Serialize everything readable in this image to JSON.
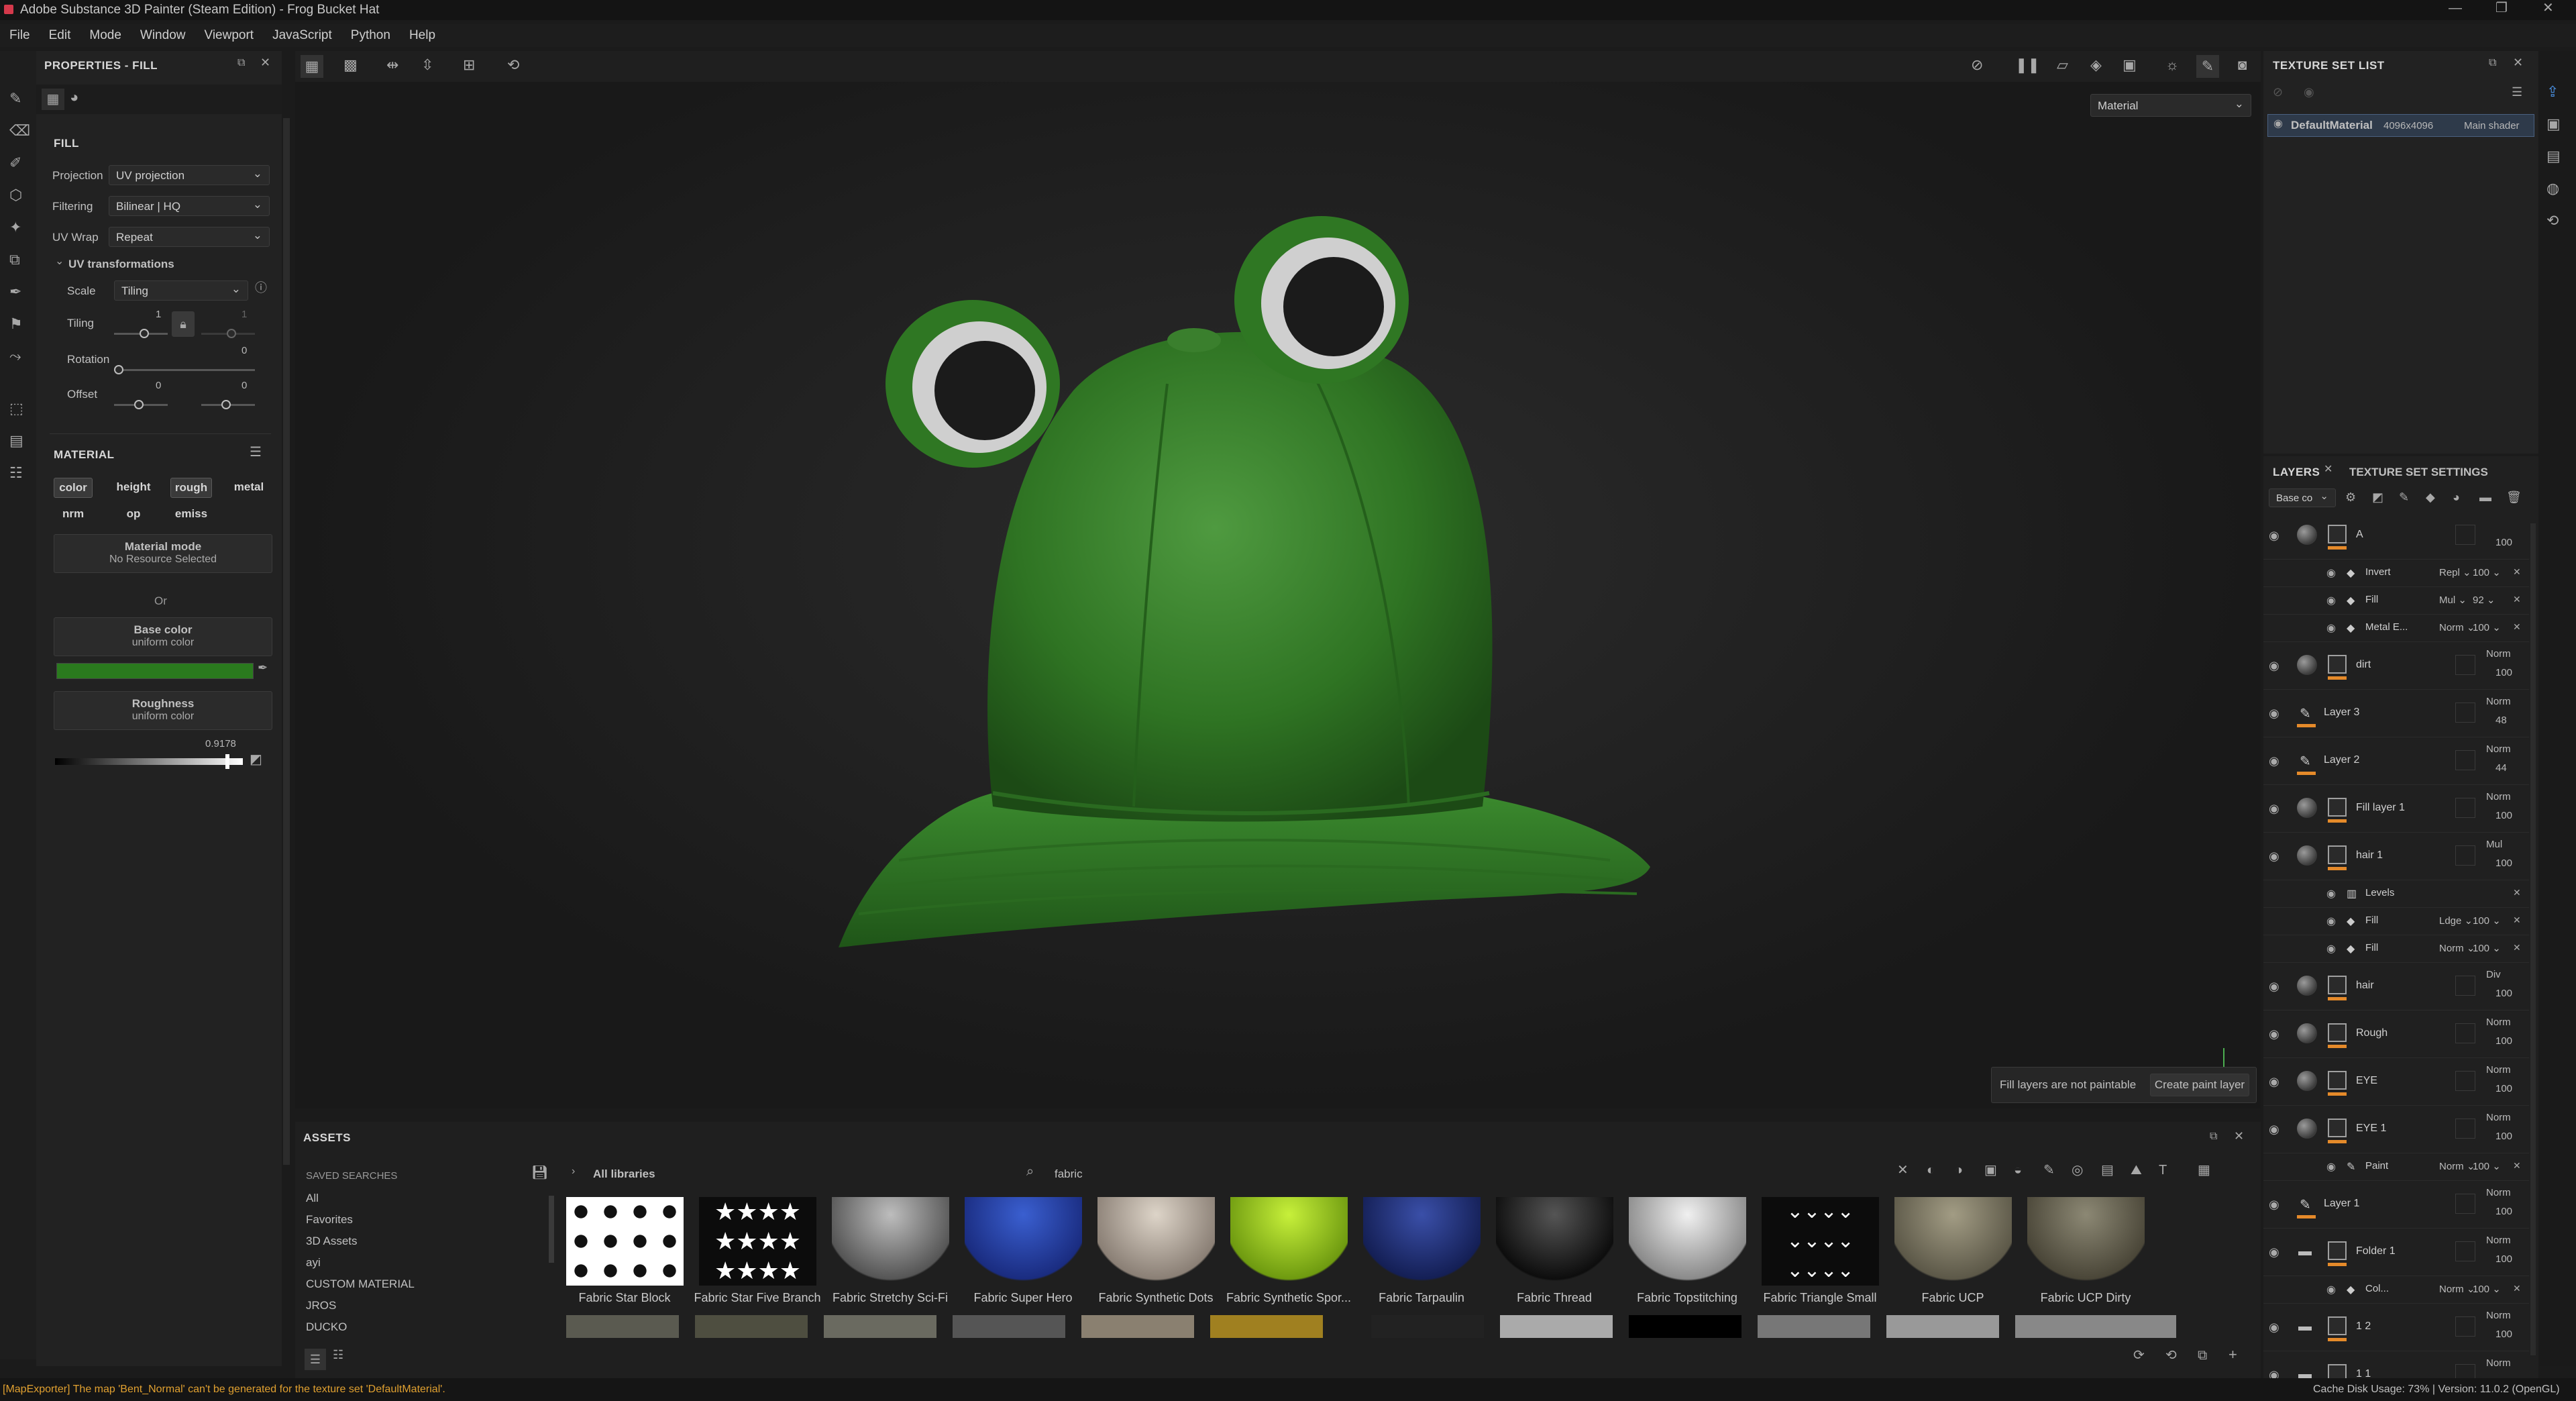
{
  "window": {
    "title": "Adobe Substance 3D Painter (Steam Edition) - Frog Bucket Hat"
  },
  "menu": [
    "File",
    "Edit",
    "Mode",
    "Window",
    "Viewport",
    "JavaScript",
    "Python",
    "Help"
  ],
  "properties": {
    "title": "PROPERTIES - FILL",
    "fill_header": "FILL",
    "projection_label": "Projection",
    "projection_value": "UV projection",
    "filtering_label": "Filtering",
    "filtering_value": "Bilinear | HQ",
    "uvwrap_label": "UV Wrap",
    "uvwrap_value": "Repeat",
    "uvtrans_label": "UV transformations",
    "scale_label": "Scale",
    "scale_value": "Tiling",
    "tiling_label": "Tiling",
    "tiling_v1": "1",
    "tiling_v2": "1",
    "rotation_label": "Rotation",
    "rotation_value": "0",
    "offset_label": "Offset",
    "offset_v1": "0",
    "offset_v2": "0",
    "material_header": "MATERIAL",
    "channels": [
      "color",
      "height",
      "rough",
      "metal",
      "nrm",
      "op",
      "emiss"
    ],
    "material_mode": "Material mode",
    "no_resource": "No Resource Selected",
    "or": "Or",
    "base_color": "Base color",
    "base_color_sub": "uniform color",
    "base_color_hex": "#2a7a1e",
    "roughness": "Roughness",
    "roughness_sub": "uniform color",
    "roughness_value": "0.9178",
    "roughness_level": 0.9178
  },
  "viewport": {
    "mode": "Material",
    "tooltip": "Fill layers are not paintable",
    "create_btn": "Create paint layer"
  },
  "texture_set": {
    "title": "TEXTURE SET LIST",
    "name": "DefaultMaterial",
    "size": "4096x4096",
    "shader": "Main shader"
  },
  "layers_panel": {
    "tab_layers": "LAYERS",
    "tab_settings": "TEXTURE SET SETTINGS",
    "channel": "Base co",
    "layers": [
      {
        "name": "A",
        "blend": "",
        "opacity": "100",
        "indent": 0,
        "kind": "fill",
        "top": true
      },
      {
        "name": "Invert",
        "blend": "Repl",
        "opacity": "100",
        "indent": 1,
        "kind": "effect"
      },
      {
        "name": "Fill",
        "blend": "Mul",
        "opacity": "92",
        "indent": 1,
        "kind": "effect"
      },
      {
        "name": "Metal E...",
        "blend": "Norm",
        "opacity": "100",
        "indent": 1,
        "kind": "effect"
      },
      {
        "name": "dirt",
        "blend": "Norm",
        "opacity": "100",
        "indent": 0,
        "kind": "fill"
      },
      {
        "name": "Layer 3",
        "blend": "Norm",
        "opacity": "48",
        "indent": 0,
        "kind": "paint"
      },
      {
        "name": "Layer 2",
        "blend": "Norm",
        "opacity": "44",
        "indent": 0,
        "kind": "paint"
      },
      {
        "name": "Fill layer 1",
        "blend": "Norm",
        "opacity": "100",
        "indent": 0,
        "kind": "fill"
      },
      {
        "name": "hair 1",
        "blend": "Mul",
        "opacity": "100",
        "indent": 0,
        "kind": "fill"
      },
      {
        "name": "Levels",
        "blend": "",
        "opacity": "",
        "indent": 1,
        "kind": "effect"
      },
      {
        "name": "Fill",
        "blend": "Ldge",
        "opacity": "100",
        "indent": 1,
        "kind": "effect"
      },
      {
        "name": "Fill",
        "blend": "Norm",
        "opacity": "100",
        "indent": 1,
        "kind": "effect"
      },
      {
        "name": "hair",
        "blend": "Div",
        "opacity": "100",
        "indent": 0,
        "kind": "fill"
      },
      {
        "name": "Rough",
        "blend": "Norm",
        "opacity": "100",
        "indent": 0,
        "kind": "fill"
      },
      {
        "name": "EYE",
        "blend": "Norm",
        "opacity": "100",
        "indent": 0,
        "kind": "fill"
      },
      {
        "name": "EYE 1",
        "blend": "Norm",
        "opacity": "100",
        "indent": 0,
        "kind": "fill"
      },
      {
        "name": "Paint",
        "blend": "Norm",
        "opacity": "100",
        "indent": 1,
        "kind": "effect"
      },
      {
        "name": "Layer 1",
        "blend": "Norm",
        "opacity": "100",
        "indent": 0,
        "kind": "paint"
      },
      {
        "name": "Folder 1",
        "blend": "Norm",
        "opacity": "100",
        "indent": 0,
        "kind": "folder"
      },
      {
        "name": "Col...",
        "blend": "Norm",
        "opacity": "100",
        "indent": 1,
        "kind": "effect"
      },
      {
        "name": "1 2",
        "blend": "Norm",
        "opacity": "100",
        "indent": 0,
        "kind": "folder"
      },
      {
        "name": "1 1",
        "blend": "Norm",
        "opacity": "",
        "indent": 0,
        "kind": "folder"
      }
    ]
  },
  "assets": {
    "title": "ASSETS",
    "saved_searches": "SAVED SEARCHES",
    "breadcrumb": "All libraries",
    "search_value": "fabric",
    "libraries": [
      "All",
      "Favorites",
      "3D Assets",
      "ayi",
      "CUSTOM MATERIAL",
      "JROS",
      "DUCKO"
    ],
    "items": [
      "Fabric Star Block",
      "Fabric Star Five Branch",
      "Fabric Stretchy Sci-Fi",
      "Fabric Super Hero",
      "Fabric Synthetic Dots",
      "Fabric Synthetic Spor...",
      "Fabric Tarpaulin",
      "Fabric Thread",
      "Fabric Topstitching",
      "Fabric Triangle Small",
      "Fabric UCP",
      "Fabric UCP Dirty"
    ]
  },
  "status": {
    "message": "[MapExporter] The map 'Bent_Normal' can't be generated for the texture set 'DefaultMaterial'.",
    "right": "Cache Disk Usage:   73% | Version: 11.0.2 (OpenGL)"
  }
}
